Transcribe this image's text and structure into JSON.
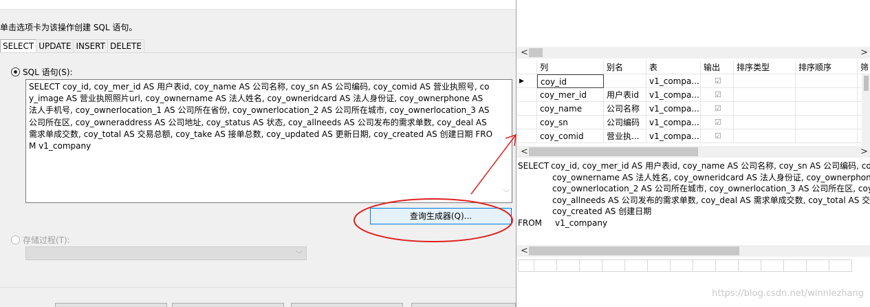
{
  "wizard": {
    "instruction": "单击选项卡为该操作创建 SQL 语句。",
    "tabs": [
      "SELECT",
      "UPDATE",
      "INSERT",
      "DELETE"
    ],
    "active_tab": "SELECT",
    "sql_radio_label": "SQL 语句(S):",
    "sql_text": "SELECT coy_id, coy_mer_id AS 用户表id, coy_name AS 公司名称, coy_sn AS 公司编码, coy_comid AS 营业执照号, coy_image AS 营业执照照片url, coy_ownername AS 法人姓名, coy_owneridcard AS 法人身份证, coy_ownerphone AS 法人手机号, coy_ownerlocation_1 AS 公司所在省份, coy_ownerlocation_2 AS 公司所在城市, coy_ownerlocation_3 AS 公司所在区, coy_owneraddress AS 公司地址, coy_status AS 状态, coy_allneeds AS 公司发布的需求单数, coy_deal AS 需求单成交数, coy_total AS 交易总额, coy_take AS 接单总数, coy_updated AS 更新日期, coy_created AS 创建日期 FROM v1_company",
    "query_builder_button": "查询生成器(Q)...",
    "proc_radio_label": "存储过程(T):",
    "proc_selected": ""
  },
  "designer": {
    "grid_headers": [
      "列",
      "别名",
      "表",
      "输出",
      "排序类型",
      "排序顺序",
      "筛"
    ],
    "grid_rows": [
      {
        "column": "coy_id",
        "alias": "",
        "table": "v1_compa...",
        "output": "☑"
      },
      {
        "column": "coy_mer_id",
        "alias": "用户表id",
        "table": "v1_compa...",
        "output": "☑"
      },
      {
        "column": "coy_name",
        "alias": "公司名称",
        "table": "v1_compa...",
        "output": "☑"
      },
      {
        "column": "coy_sn",
        "alias": "公司编码",
        "table": "v1_compa...",
        "output": "☑"
      },
      {
        "column": "coy_comid",
        "alias": "营业执...",
        "table": "v1_compa...",
        "output": "☑"
      }
    ],
    "current_row_marker": "▶",
    "sql_lines": [
      {
        "kw": "SELECT",
        "text": "coy_id, coy_mer_id AS 用户表id, coy_name AS 公司名称, coy_sn AS 公司编码, coy_co"
      },
      {
        "kw": "",
        "text": "coy_ownername AS 法人姓名, coy_owneridcard AS 法人身份证, coy_ownerphone A"
      },
      {
        "kw": "",
        "text": "coy_ownerlocation_2 AS 公司所在城市, coy_ownerlocation_3 AS 公司所在区, coy_ow"
      },
      {
        "kw": "",
        "text": "coy_allneeds AS 公司发布的需求单数, coy_deal AS 需求单成交数, coy_total AS 交易总"
      },
      {
        "kw": "",
        "text": "coy_created AS 创建日期"
      },
      {
        "kw": "FROM",
        "text": "v1_company"
      }
    ],
    "scroll_left": "<",
    "scroll_right": ">"
  },
  "watermark": "https://blog.csdn.net/winnlezhang",
  "colors": {
    "annotation_red": "#e0201e",
    "button_focus": "#0078d7",
    "button_bg": "#e5f1fb"
  }
}
